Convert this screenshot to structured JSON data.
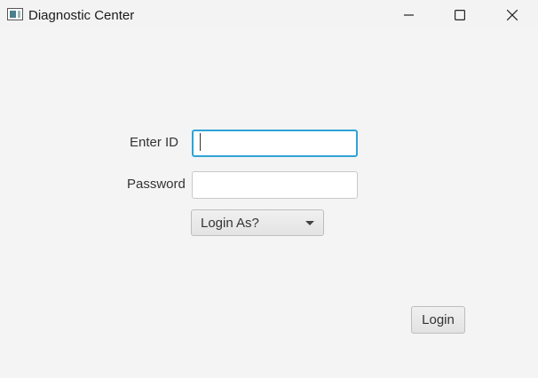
{
  "window": {
    "title": "Diagnostic Center",
    "icon": "app-window-icon",
    "controls": [
      "minimize-icon",
      "maximize-icon",
      "close-icon"
    ]
  },
  "form": {
    "id_label": "Enter ID",
    "id_value": "",
    "password_label": "Password",
    "password_value": "",
    "role_select_label": "Login As?",
    "login_button": "Login"
  },
  "colors": {
    "background": "#f4f4f4",
    "focus_border": "#2fa3d6"
  }
}
